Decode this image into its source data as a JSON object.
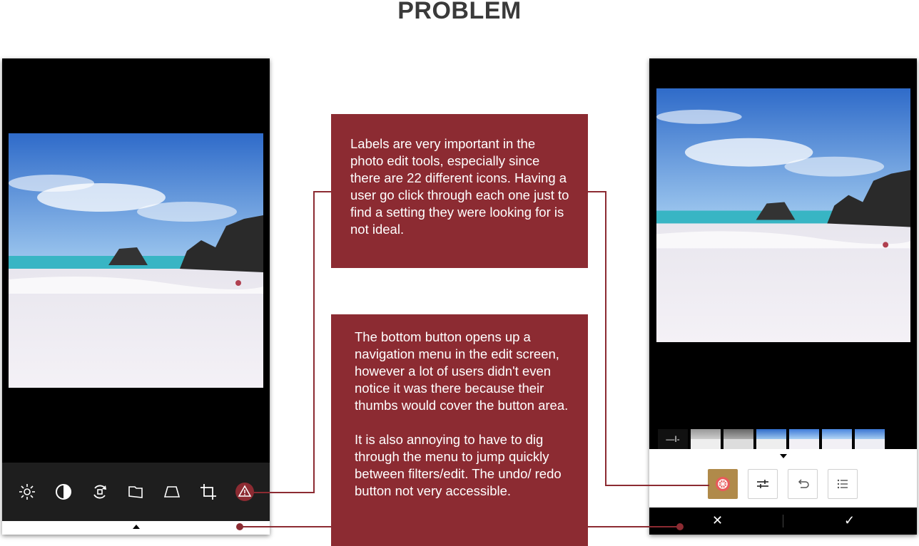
{
  "page_title": "PROBLEM",
  "colors": {
    "accent": "#8c2b32",
    "highlight": "#b08a4a",
    "toolbar": "#1e1e1e"
  },
  "callouts": {
    "labels_note": "Labels are very important in the photo edit tools, especially since there are 22 different icons. Having a user go click through each one just to find a setting they were looking for is not ideal.",
    "bottom_button_note": "The bottom button opens up a navigation menu in the edit screen, however a lot of users didn't even notice it was there because their thumbs would cover the button area.",
    "menu_note": "It is also annoying to have to dig through the menu to jump quickly between filters/edit. The undo/ redo button not very accessible."
  },
  "left_screen": {
    "tools": [
      "brightness-icon",
      "contrast-icon",
      "rotate-icon",
      "flag-icon",
      "perspective-icon",
      "crop-icon",
      "warning-icon"
    ]
  },
  "right_screen": {
    "filter_strip_first_label": "—I-",
    "controls": [
      "filters-icon",
      "adjust-icon",
      "undo-icon",
      "list-icon"
    ],
    "cancel_label": "✕",
    "confirm_label": "✓"
  }
}
